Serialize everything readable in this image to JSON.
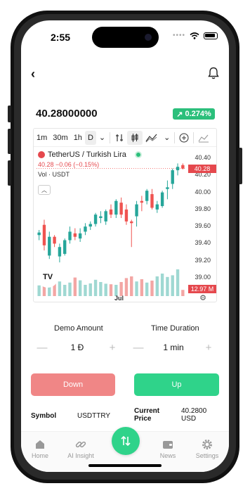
{
  "status": {
    "time": "2:55"
  },
  "header": {
    "price": "40.28000000",
    "change": "0.274%",
    "change_arrow": "↗"
  },
  "chart_toolbar": {
    "intervals": [
      "1m",
      "30m",
      "1h",
      "D"
    ],
    "active_interval": "D",
    "caret": "⌄"
  },
  "chart_legend": {
    "pair": "TetherUS / Turkish Lira",
    "ohlc": "40.28 −0.06 (−0.15%)",
    "volume_label": "Vol · USDT",
    "tv_logo": "TV"
  },
  "chart_data": {
    "type": "bar",
    "title": "TetherUS / Turkish Lira",
    "y_axis_ticks": [
      40.4,
      40.2,
      40.0,
      39.8,
      39.6,
      39.4,
      39.2,
      39.0
    ],
    "y_axis_labels": [
      "40.40",
      "40.20",
      "40.00",
      "39.80",
      "39.60",
      "39.40",
      "39.20",
      "39.00"
    ],
    "ylim": [
      38.95,
      40.45
    ],
    "x_axis_labels": [
      "Jul"
    ],
    "last_price_label": "40.28",
    "volume_label": "12.97 M",
    "colors": {
      "up": "#26a69a",
      "down": "#ef5350",
      "up_vol": "#9fd8d2",
      "down_vol": "#f3a6a4"
    },
    "candles": [
      {
        "o": 39.5,
        "h": 39.56,
        "l": 39.44,
        "c": 39.53
      },
      {
        "o": 39.62,
        "h": 39.68,
        "l": 39.32,
        "c": 39.38
      },
      {
        "o": 39.26,
        "h": 39.54,
        "l": 39.22,
        "c": 39.48
      },
      {
        "o": 39.48,
        "h": 39.5,
        "l": 39.36,
        "c": 39.4
      },
      {
        "o": 39.25,
        "h": 39.4,
        "l": 39.18,
        "c": 39.36
      },
      {
        "o": 39.28,
        "h": 39.46,
        "l": 39.26,
        "c": 39.44
      },
      {
        "o": 39.44,
        "h": 39.6,
        "l": 39.4,
        "c": 39.54
      },
      {
        "o": 39.52,
        "h": 39.58,
        "l": 39.44,
        "c": 39.48
      },
      {
        "o": 39.46,
        "h": 39.58,
        "l": 39.42,
        "c": 39.52
      },
      {
        "o": 39.54,
        "h": 39.64,
        "l": 39.5,
        "c": 39.6
      },
      {
        "o": 39.6,
        "h": 39.66,
        "l": 39.56,
        "c": 39.63
      },
      {
        "o": 39.63,
        "h": 39.76,
        "l": 39.6,
        "c": 39.74
      },
      {
        "o": 39.7,
        "h": 39.78,
        "l": 39.64,
        "c": 39.72
      },
      {
        "o": 39.66,
        "h": 39.8,
        "l": 39.62,
        "c": 39.78
      },
      {
        "o": 39.8,
        "h": 39.86,
        "l": 39.7,
        "c": 39.74
      },
      {
        "o": 39.74,
        "h": 39.92,
        "l": 39.7,
        "c": 39.9
      },
      {
        "o": 39.88,
        "h": 39.94,
        "l": 39.7,
        "c": 39.74
      },
      {
        "o": 39.8,
        "h": 39.86,
        "l": 39.62,
        "c": 39.66
      },
      {
        "o": 39.66,
        "h": 39.68,
        "l": 39.36,
        "c": 39.64
      },
      {
        "o": 39.72,
        "h": 39.9,
        "l": 39.6,
        "c": 39.86
      },
      {
        "o": 39.9,
        "h": 39.96,
        "l": 39.78,
        "c": 39.88
      },
      {
        "o": 39.9,
        "h": 40.04,
        "l": 39.86,
        "c": 40.02
      },
      {
        "o": 39.98,
        "h": 40.04,
        "l": 39.8,
        "c": 39.82
      },
      {
        "o": 39.8,
        "h": 39.9,
        "l": 39.76,
        "c": 39.86
      },
      {
        "o": 39.84,
        "h": 40.02,
        "l": 39.82,
        "c": 40.0
      },
      {
        "o": 40.04,
        "h": 40.14,
        "l": 39.92,
        "c": 40.06
      },
      {
        "o": 40.1,
        "h": 40.28,
        "l": 40.04,
        "c": 40.26
      },
      {
        "o": 40.26,
        "h": 40.34,
        "l": 40.2,
        "c": 40.3
      },
      {
        "o": 40.32,
        "h": 40.34,
        "l": 40.27,
        "c": 40.28
      }
    ],
    "volumes": [
      0.38,
      0.55,
      0.45,
      0.62,
      0.52,
      0.4,
      0.48,
      0.66,
      0.56,
      0.4,
      0.45,
      0.58,
      0.5,
      0.44,
      0.42,
      0.4,
      0.5,
      0.64,
      0.7,
      0.52,
      0.6,
      0.48,
      0.55,
      0.7,
      0.8,
      0.68,
      0.74,
      0.95,
      0.22
    ]
  },
  "trade": {
    "demo_amount_label": "Demo Amount",
    "time_duration_label": "Time Duration",
    "amount_value": "1 Đ",
    "duration_value": "1 min",
    "minus": "—",
    "plus": "+",
    "down_label": "Down",
    "up_label": "Up",
    "down_color": "#f08686",
    "up_color": "#2fd38a"
  },
  "info": {
    "symbol_label": "Symbol",
    "symbol_value": "USDTTRY",
    "current_price_label_1": "Current",
    "current_price_label_2": "Price",
    "current_price_value_1": "40.2800",
    "current_price_value_2": "USD"
  },
  "nav": {
    "items": [
      {
        "label": "Home",
        "icon": "home-icon"
      },
      {
        "label": "AI Insight",
        "icon": "link-icon"
      },
      {
        "label": "News",
        "icon": "wallet-icon"
      },
      {
        "label": "Settings",
        "icon": "gear-icon"
      }
    ],
    "fab_icon": "swap-icon"
  }
}
